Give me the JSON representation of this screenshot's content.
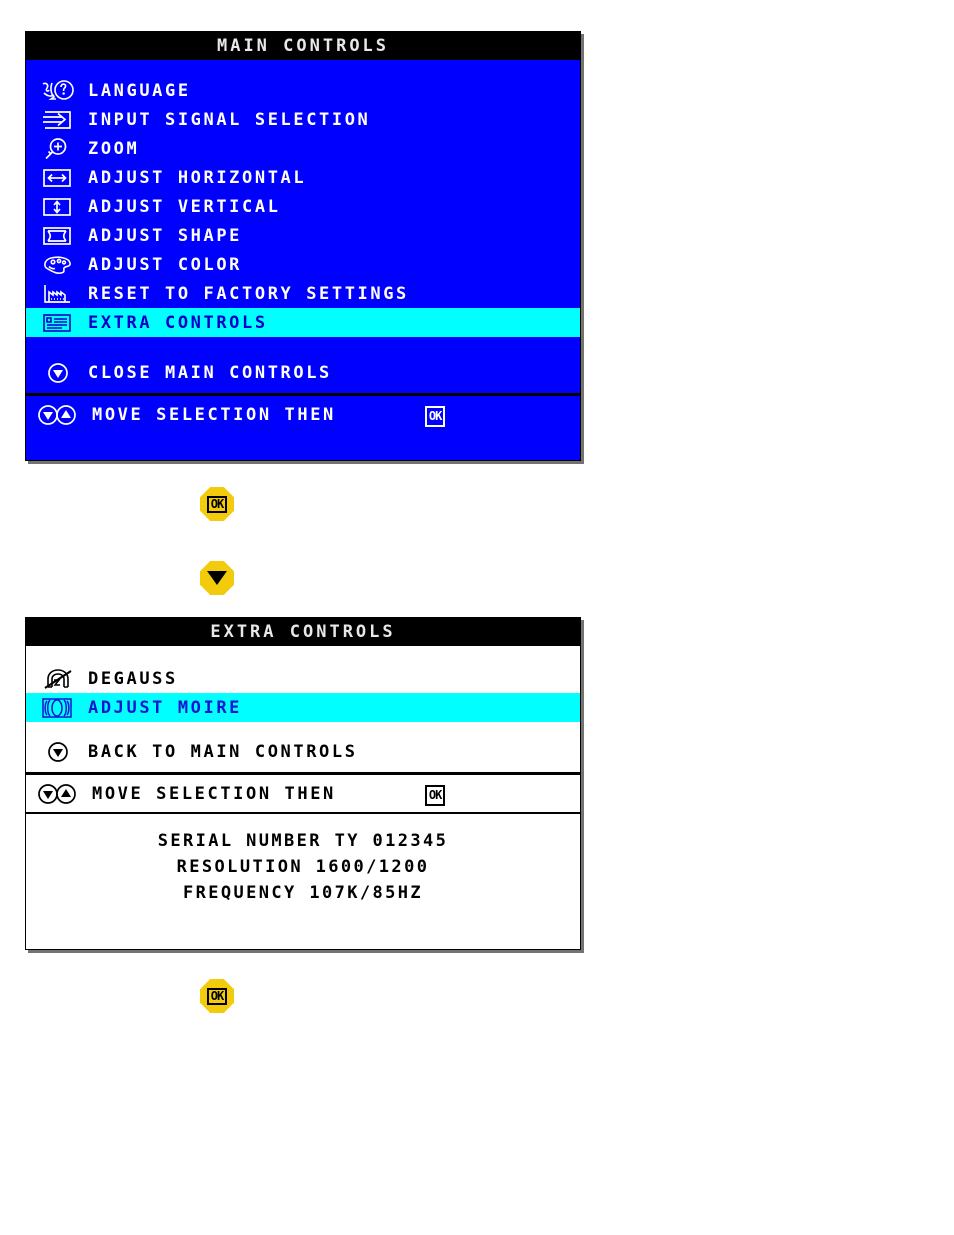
{
  "main_controls": {
    "title": "MAIN CONTROLS",
    "background_color": "#0000FF",
    "text_color": "#FFFFFF",
    "highlight_color": "#00FFFF",
    "highlight_text_color": "#0000CC",
    "items": [
      {
        "icon": "language-head-question-icon",
        "label": "LANGUAGE",
        "selected": false
      },
      {
        "icon": "input-signal-arrow-icon",
        "label": "INPUT SIGNAL SELECTION",
        "selected": false
      },
      {
        "icon": "zoom-magnifier-plus-icon",
        "label": "ZOOM",
        "selected": false
      },
      {
        "icon": "adjust-horizontal-icon",
        "label": "ADJUST HORIZONTAL",
        "selected": false
      },
      {
        "icon": "adjust-vertical-icon",
        "label": "ADJUST VERTICAL",
        "selected": false
      },
      {
        "icon": "adjust-shape-icon",
        "label": "ADJUST SHAPE",
        "selected": false
      },
      {
        "icon": "adjust-color-palette-icon",
        "label": "ADJUST COLOR",
        "selected": false
      },
      {
        "icon": "reset-factory-icon",
        "label": "RESET TO FACTORY SETTINGS",
        "selected": false
      },
      {
        "icon": "extra-controls-list-icon",
        "label": "EXTRA CONTROLS",
        "selected": true
      }
    ],
    "action": {
      "icon": "down-arrow-circle-icon",
      "label": "CLOSE MAIN CONTROLS"
    },
    "hint": {
      "icon": "down-up-arrow-circles-icon",
      "label": "MOVE SELECTION THEN",
      "ok_glyph": "OK"
    }
  },
  "extra_controls": {
    "title": "EXTRA CONTROLS",
    "background_color": "#FFFFFF",
    "text_color": "#000000",
    "highlight_color": "#00FFFF",
    "highlight_text_color": "#1414D2",
    "items": [
      {
        "icon": "degauss-magnet-icon",
        "label": "DEGAUSS",
        "selected": false
      },
      {
        "icon": "adjust-moire-icon",
        "label": "ADJUST MOIRE",
        "selected": true
      }
    ],
    "action": {
      "icon": "down-arrow-circle-icon",
      "label": "BACK TO MAIN CONTROLS"
    },
    "hint": {
      "icon": "down-up-arrow-circles-icon",
      "label": "MOVE SELECTION THEN",
      "ok_glyph": "OK"
    },
    "info": [
      "SERIAL NUMBER TY 012345",
      "RESOLUTION 1600/1200",
      "FREQUENCY 107K/85HZ"
    ]
  },
  "buttons": {
    "ok_after_main": {
      "icon": "ok-button-icon",
      "label": "OK",
      "color": "#F2CC0C"
    },
    "down_after_main": {
      "icon": "down-button-icon",
      "label": "",
      "color": "#F2CC0C"
    },
    "ok_after_extra": {
      "icon": "ok-button-icon",
      "label": "OK",
      "color": "#F2CC0C"
    }
  }
}
